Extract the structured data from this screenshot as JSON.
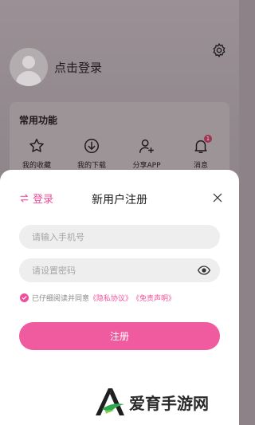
{
  "profile": {
    "login_label": "点击登录"
  },
  "features": {
    "title": "常用功能",
    "items": [
      {
        "label": "我的收藏",
        "icon": "star-icon"
      },
      {
        "label": "我的下载",
        "icon": "download-icon"
      },
      {
        "label": "分享APP",
        "icon": "add-user-icon"
      },
      {
        "label": "消息",
        "icon": "bell-icon",
        "badge": "1"
      }
    ]
  },
  "sheet": {
    "switch_label": "登录",
    "title": "新用户注册",
    "phone_placeholder": "请输入手机号",
    "password_placeholder": "请设置密码",
    "agreement": {
      "prefix": "已仔细阅读并同意",
      "privacy": "《隐私协议》",
      "disclaimer": "《免责声明》"
    },
    "submit_label": "注册"
  },
  "watermark": {
    "text": "爱育手游网"
  },
  "colors": {
    "accent": "#f0509a",
    "button": "#f05a9e"
  }
}
